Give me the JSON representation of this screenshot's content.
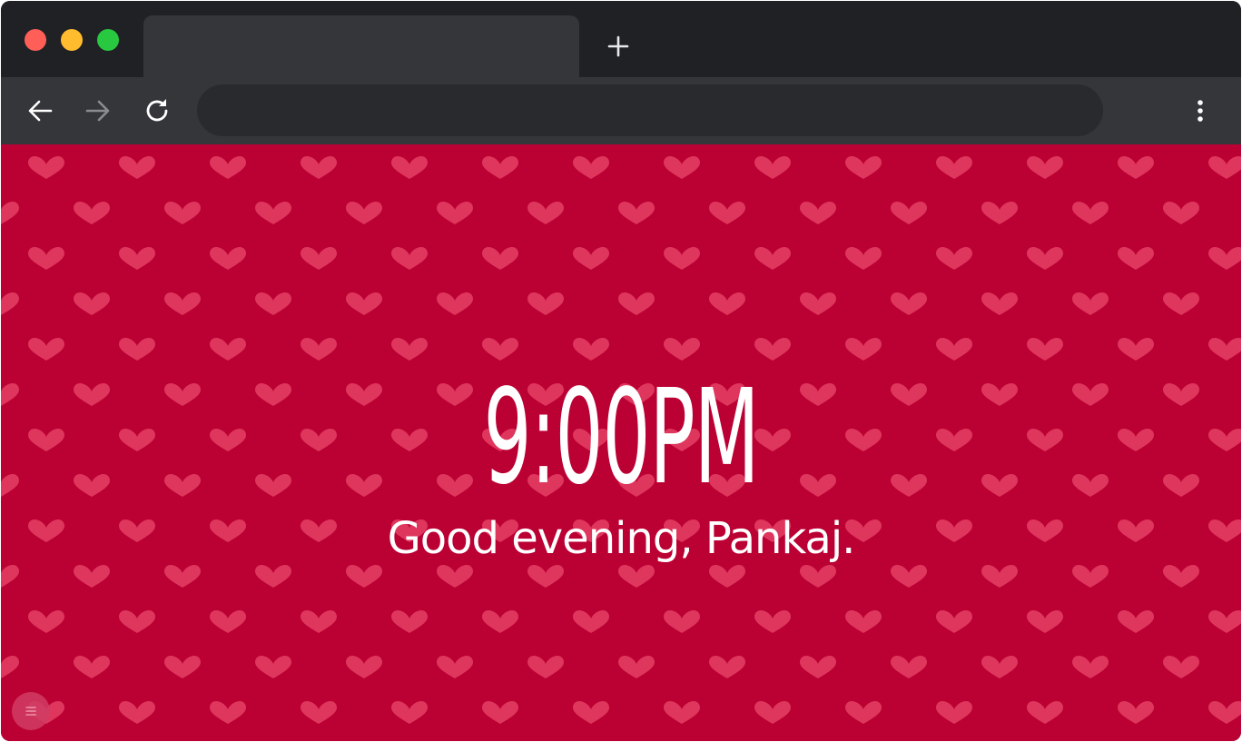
{
  "browser": {
    "tab_count": 1,
    "omnibox": {
      "value": "",
      "placeholder": ""
    },
    "buttons": {
      "back": "back-arrow-icon",
      "forward": "forward-arrow-icon",
      "reload": "reload-icon",
      "new_tab": "plus-icon",
      "menu": "more-vert-icon"
    }
  },
  "page": {
    "background_color": "#bb0033",
    "pattern_color": "#e0375e",
    "pattern_icon": "heart-icon",
    "time": "9:00PM",
    "greeting": "Good evening, Pankaj.",
    "corner_button_icon": "menu-lines-icon"
  },
  "colors": {
    "tab_strip": "#202124",
    "toolbar": "#35363a",
    "traffic_red": "#ff5f57",
    "traffic_yellow": "#febc2e",
    "traffic_green": "#28c840"
  }
}
